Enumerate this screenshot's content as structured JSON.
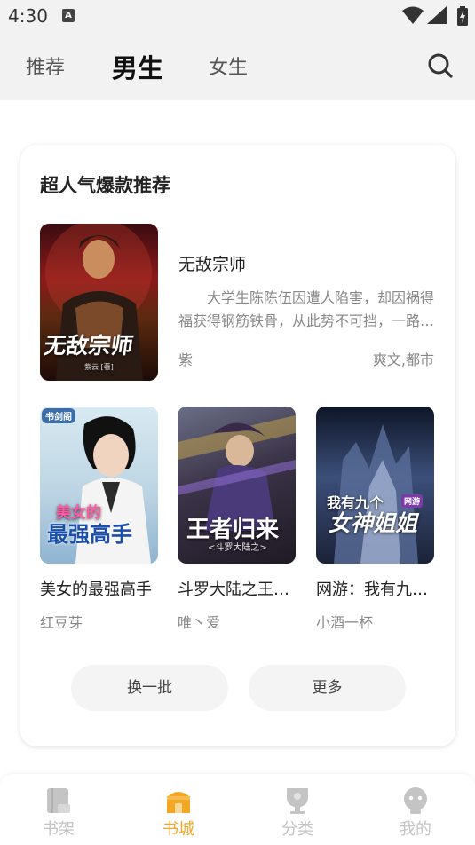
{
  "status": {
    "time": "4:30",
    "notif_letter": "A"
  },
  "tabs": [
    {
      "label": "推荐",
      "active": false
    },
    {
      "label": "男生",
      "active": true
    },
    {
      "label": "女生",
      "active": false
    }
  ],
  "section": {
    "title": "超人气爆款推荐"
  },
  "featured": {
    "title": "无敌宗师",
    "description": "大学生陈陈伍因遭人陷害，却因祸得福获得钢筋铁骨，从此势不可挡，一路高歌猛进，成就无敌宗师之名……",
    "author": "紫",
    "tags": "爽文,都市",
    "cover_text": "无敌宗师",
    "cover_small": "紫云 [著]"
  },
  "books": [
    {
      "title": "美女的最强高手",
      "author": "红豆芽",
      "cover_text_1": "美女的",
      "cover_text_2": "最强高手",
      "cover_badge": "书剑阁"
    },
    {
      "title": "斗罗大陆之王者归来",
      "author": "唯丶爱",
      "cover_text_1": "王者归来",
      "cover_text_2": "<斗罗大陆之>",
      "cover_badge": ""
    },
    {
      "title": "网游：我有九个女神姐姐",
      "author": "小酒一杯",
      "cover_text_1": "我有九个",
      "cover_text_2": "女神姐姐",
      "cover_badge": "网游"
    }
  ],
  "actions": {
    "change": "换一批",
    "more": "更多"
  },
  "bottom_nav": [
    {
      "label": "书架",
      "icon": "bookshelf-icon",
      "active": false
    },
    {
      "label": "书城",
      "icon": "bookstore-icon",
      "active": true
    },
    {
      "label": "分类",
      "icon": "category-icon",
      "active": false
    },
    {
      "label": "我的",
      "icon": "profile-icon",
      "active": false
    }
  ],
  "colors": {
    "accent": "#f5a623",
    "inactive": "#c4c4c4",
    "background": "#f2f2f2"
  }
}
